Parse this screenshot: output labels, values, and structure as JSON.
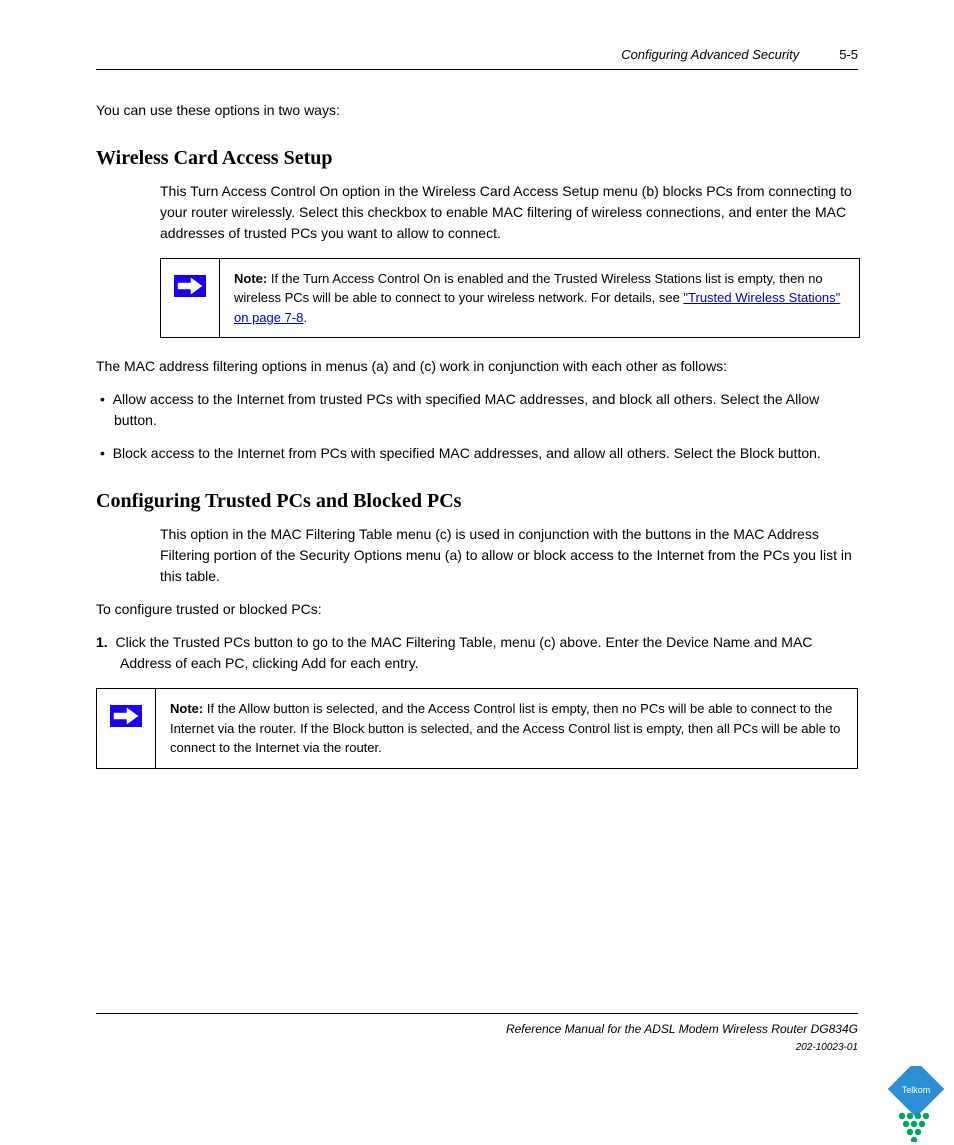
{
  "header": {
    "chapter": "Configuring Advanced Security",
    "page": "5-5"
  },
  "intro": "You can use these options in two ways:",
  "option_a": {
    "heading": "Wireless Card Access Setup",
    "text": "This Turn Access Control On option in the Wireless Card Access Setup menu (b) blocks PCs from connecting to your router wirelessly. Select this checkbox to enable MAC filtering of wireless connections, and enter the MAC addresses of trusted PCs you want to allow to connect."
  },
  "note1": {
    "label": "Note:",
    "text_before": "If the Turn Access Control On is enabled and the Trusted Wireless Stations list is empty, then no wireless PCs will be able to connect to your wireless network. For details, see ",
    "link": "\"Trusted Wireless Stations\" on page 7-8",
    "text_after": "."
  },
  "list_intro": "The MAC address filtering options in menus (a) and (c) work in conjunction with each other as follows:",
  "bullet1": "Allow access to the Internet from trusted PCs with specified MAC addresses, and block all others. Select the Allow button.",
  "bullet2": "Block access to the Internet from PCs with specified MAC addresses, and allow all others. Select the Block button.",
  "config_heading": "Configuring Trusted PCs and Blocked PCs",
  "option_b_text": "This option in the MAC Filtering Table menu (c) is used in conjunction with the buttons in the MAC Address Filtering portion of the Security Options menu (a) to allow or block access to the Internet from the PCs you list in this table.",
  "config_body": "To configure trusted or blocked PCs:",
  "step1_num": "1.",
  "step1_text": "Click the Trusted PCs button to go to the MAC Filtering Table, menu (c) above. Enter the Device Name and MAC Address of each PC, clicking Add for each entry.",
  "note2": {
    "label": "Note:",
    "text": "If the Allow button is selected, and the Access Control list is empty, then no PCs will be able to connect to the Internet via the router. If the Block button is selected, and the Access Control list is empty, then all PCs will be able to connect to the Internet via the router."
  },
  "footer": {
    "title": "Reference Manual for the ADSL Modem Wireless Router DG834G",
    "version": "202-10023-01"
  },
  "logo_text": "Telkom"
}
